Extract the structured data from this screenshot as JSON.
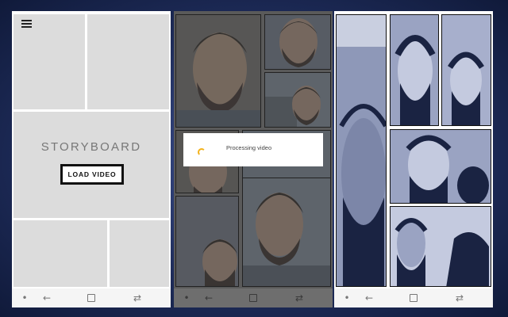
{
  "storyboard_screen": {
    "menu_icon": "hamburger-menu-icon",
    "title": "STORYBOARD",
    "load_button_label": "LOAD VIDEO"
  },
  "processing_screen": {
    "toast_text": "Processing video",
    "spinner_color": "#f3b21b"
  },
  "result_screen": {
    "panel_ink_color": "#1a2342",
    "panel_tone_color": "#9aa3c2"
  },
  "navbar": {
    "icons": [
      "dot-icon",
      "back-arrow-icon",
      "home-square-icon",
      "recent-apps-icon"
    ]
  }
}
